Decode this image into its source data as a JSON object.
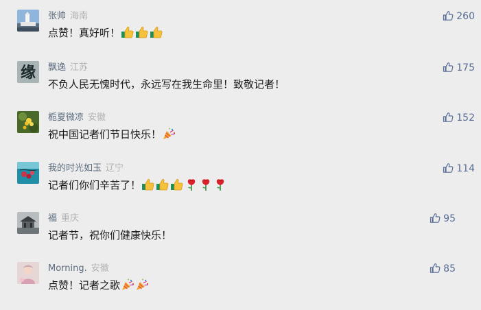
{
  "comments": [
    {
      "user": "张帅",
      "region": "海南",
      "text": "点赞！真好听！",
      "emoji": [
        "thumbs-up-icon",
        "thumbs-up-icon",
        "thumbs-up-icon"
      ],
      "likes": "260",
      "avatar": "lighthouse-avatar"
    },
    {
      "user": "飘逸",
      "region": "江苏",
      "text": "不负人民无愧时代，永远写在我生命里！致敬记者！",
      "emoji": [],
      "likes": "175",
      "avatar": "calligraphy-avatar",
      "avatar_char": "缘"
    },
    {
      "user": "栀夏微凉",
      "region": "安徽",
      "text": "祝中国记者们节日快乐！",
      "emoji": [
        "party-popper-icon"
      ],
      "likes": "152",
      "avatar": "flower-avatar"
    },
    {
      "user": "我的时光如玉",
      "region": "辽宁",
      "text": "记者们你们辛苦了！",
      "emoji": [
        "thumbs-up-icon",
        "thumbs-up-icon",
        "thumbs-up-icon",
        "rose-icon",
        "rose-icon",
        "rose-icon"
      ],
      "likes": "114",
      "avatar": "berries-avatar"
    },
    {
      "user": "福",
      "region": "重庆",
      "text": "记者节，祝你们健康快乐！",
      "emoji": [],
      "likes": "95",
      "avatar": "pavilion-avatar"
    },
    {
      "user": "Morning.",
      "region": "安徽",
      "text": "点赞！记者之歌",
      "emoji": [
        "party-popper-icon",
        "party-popper-icon"
      ],
      "likes": "85",
      "avatar": "portrait-avatar"
    }
  ]
}
